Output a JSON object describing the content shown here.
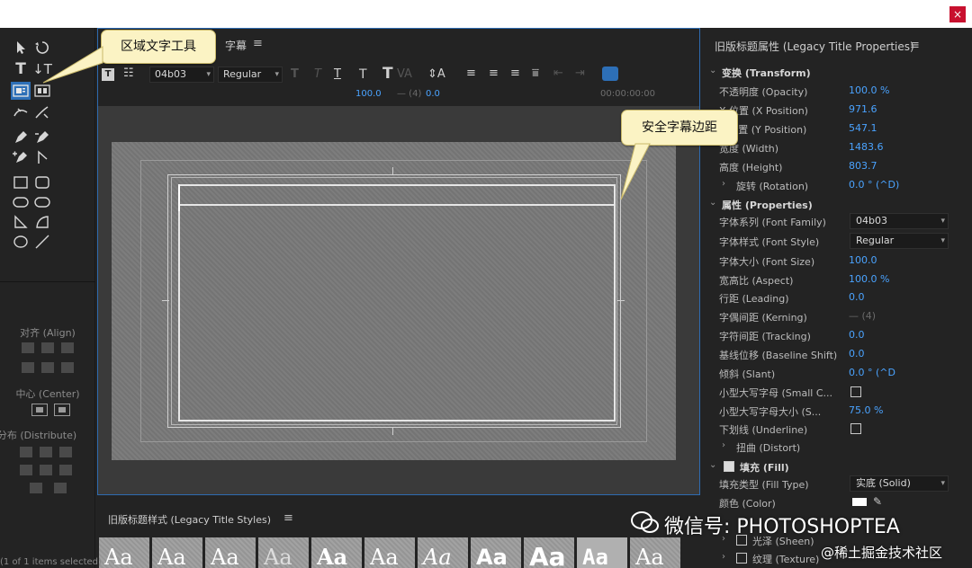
{
  "window": {
    "close_icon": "×"
  },
  "tools": {
    "align_label": "对齐 (Align)",
    "center_label": "中心 (Center)",
    "distribute_label": "分布 (Distribute)"
  },
  "title_panel": {
    "name": "字幕",
    "toolbar": {
      "font_family": "04b03",
      "font_style": "Regular",
      "font_size": "100.0",
      "kerning": "— (4)",
      "leading": "0.0",
      "timecode": "00:00:00:00"
    }
  },
  "callouts": {
    "area_text_tool": "区域文字工具",
    "safe_title_margin": "安全字幕边距"
  },
  "styles_panel": {
    "title": "旧版标题样式 (Legacy Title Styles)",
    "swatches": [
      "Aa",
      "Aa",
      "Aa",
      "Aa",
      "Aa",
      "Aa",
      "Aa",
      "Aa",
      "Aa",
      "Aa",
      "Aa"
    ],
    "status": "(1 of 1 items selected)"
  },
  "properties": {
    "title": "旧版标题属性 (Legacy Title Properties)",
    "transform": {
      "header": "变换 (Transform)",
      "opacity_label": "不透明度 (Opacity)",
      "opacity_value": "100.0 %",
      "x_label": "X 位置 (X Position)",
      "x_value": "971.6",
      "y_label": "Y 位置 (Y Position)",
      "y_value": "547.1",
      "width_label": "宽度 (Width)",
      "width_value": "1483.6",
      "height_label": "高度 (Height)",
      "height_value": "803.7",
      "rotation_label": "旋转 (Rotation)",
      "rotation_value": "0.0 ° (^D)"
    },
    "properties": {
      "header": "属性 (Properties)",
      "font_family_label": "字体系列 (Font Family)",
      "font_family_value": "04b03",
      "font_style_label": "字体样式 (Font Style)",
      "font_style_value": "Regular",
      "font_size_label": "字体大小 (Font Size)",
      "font_size_value": "100.0",
      "aspect_label": "宽高比 (Aspect)",
      "aspect_value": "100.0 %",
      "leading_label": "行距 (Leading)",
      "leading_value": "0.0",
      "kerning_label": "字偶间距 (Kerning)",
      "kerning_value": "— (4)",
      "tracking_label": "字符间距 (Tracking)",
      "tracking_value": "0.0",
      "baseline_label": "基线位移 (Baseline Shift)",
      "baseline_value": "0.0",
      "slant_label": "倾斜 (Slant)",
      "slant_value": "0.0 ° (^D",
      "small_caps_label": "小型大写字母 (Small C...",
      "small_caps_size_label": "小型大写字母大小 (S...",
      "small_caps_size_value": "75.0 %",
      "underline_label": "下划线 (Underline)",
      "distort_label": "扭曲 (Distort)"
    },
    "fill": {
      "header": "填充 (Fill)",
      "fill_type_label": "填充类型 (Fill Type)",
      "fill_type_value": "实底 (Solid)",
      "color_label": "颜色 (Color)",
      "sheen_label": "光泽 (Sheen)",
      "texture_label": "纹理 (Texture)"
    }
  },
  "watermarks": {
    "wechat": "微信号: PHOTOSHOPTEA",
    "juejin": "@稀土掘金技术社区"
  }
}
